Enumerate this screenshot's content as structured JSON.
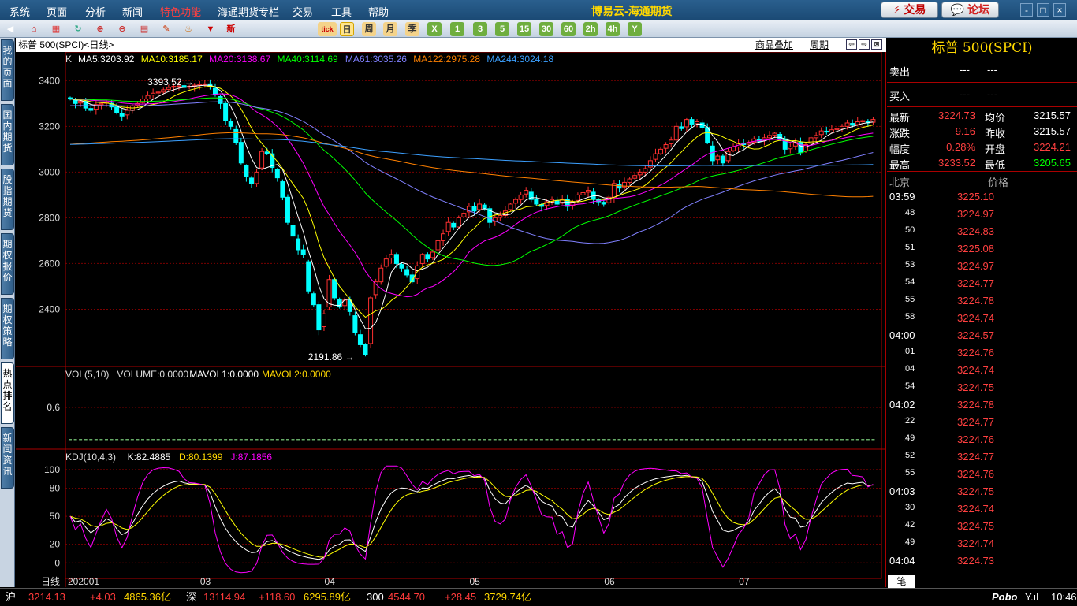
{
  "menu": [
    "系统",
    "页面",
    "分析",
    "新闻",
    "特色功能",
    "海通期货专栏",
    "交易",
    "工具",
    "帮助"
  ],
  "app_title": "博易云-海通期货",
  "buttons": {
    "trade": "交易",
    "forum": "论坛"
  },
  "window_controls": [
    "-",
    "□",
    "×"
  ],
  "toolbar": {
    "nav_icons": [
      "back-icon",
      "home-icon",
      "page-icon",
      "refresh-icon",
      "zoom-in-icon",
      "zoom-out-icon",
      "layout-icon",
      "draw-icon",
      "indicator-icon",
      "filter-icon",
      "new-icon"
    ],
    "periods": [
      "tick",
      "日",
      "周",
      "月",
      "季",
      "X",
      "1",
      "3",
      "5",
      "15",
      "30",
      "60",
      "2h",
      "4h",
      "Y"
    ],
    "active_period": "日"
  },
  "sidetabs": [
    "我的页面",
    "国内期货",
    "股指期货",
    "期权报价",
    "期权策略",
    "热点排名",
    "新闻资讯"
  ],
  "active_sidetab": "热点排名",
  "chart_header": {
    "title": "标普 500(SPCI)<日线>",
    "overlay": "商品叠加",
    "period": "周期"
  },
  "main_legend": {
    "k": "K",
    "ma": [
      {
        "label": "MA5:3203.92",
        "color": "#ffffff"
      },
      {
        "label": "MA10:3185.17",
        "color": "#ffff00"
      },
      {
        "label": "MA20:3138.67",
        "color": "#ff00ff"
      },
      {
        "label": "MA40:3114.69",
        "color": "#00ff00"
      },
      {
        "label": "MA61:3035.26",
        "color": "#8080ff"
      },
      {
        "label": "MA122:2975.28",
        "color": "#ff8000"
      },
      {
        "label": "MA244:3024.18",
        "color": "#3ca0ff"
      }
    ]
  },
  "vol_legend": {
    "title": "VOL(5,10)",
    "volume": "VOLUME:0.0000",
    "mavol1": "MAVOL1:0.0000",
    "mavol2": "MAVOL2:0.0000"
  },
  "kdj_legend": {
    "title": "KDJ(10,4,3)",
    "k": "K:82.4885",
    "d": "D:80.1399",
    "j": "J:87.1856"
  },
  "x_axis": {
    "label": "日线",
    "ticks": [
      "202001",
      "03",
      "04",
      "05",
      "06",
      "07"
    ]
  },
  "colors": {
    "up": "#ff3030",
    "down": "#00ffff",
    "grid": "#7a0000"
  },
  "chart_data": [
    {
      "type": "candlestick",
      "name": "main",
      "y_axis_ticks": [
        3400,
        3200,
        3000,
        2800,
        2600,
        2400
      ],
      "ylim": [
        2150,
        3470
      ],
      "annotations": [
        {
          "text": "3393.52",
          "value": 3393.52
        },
        {
          "text": "2191.86",
          "value": 2191.86
        }
      ],
      "close": [
        3320,
        3300,
        3310,
        3280,
        3270,
        3295,
        3300,
        3305,
        3285,
        3260,
        3245,
        3270,
        3290,
        3300,
        3320,
        3335,
        3345,
        3350,
        3360,
        3370,
        3375,
        3380,
        3370,
        3375,
        3380,
        3385,
        3386,
        3373,
        3338,
        3300,
        3225,
        3200,
        3130,
        3040,
        2980,
        2950,
        3000,
        3090,
        3080,
        3020,
        2975,
        2890,
        2780,
        2720,
        2660,
        2640,
        2480,
        2420,
        2310,
        2380,
        2530,
        2450,
        2410,
        2440,
        2390,
        2300,
        2245,
        2200,
        2450,
        2520,
        2580,
        2620,
        2640,
        2600,
        2580,
        2550,
        2520,
        2590,
        2640,
        2620,
        2650,
        2700,
        2730,
        2780,
        2760,
        2800,
        2820,
        2850,
        2830,
        2860,
        2840,
        2780,
        2800,
        2810,
        2830,
        2860,
        2880,
        2900,
        2920,
        2880,
        2860,
        2850,
        2870,
        2880,
        2860,
        2880,
        2850,
        2870,
        2900,
        2910,
        2920,
        2880,
        2870,
        2860,
        2890,
        2950,
        2930,
        2955,
        2970,
        2985,
        3000,
        3015,
        3050,
        3080,
        3100,
        3120,
        3140,
        3200,
        3190,
        3230,
        3210,
        3220,
        3195,
        3130,
        3050,
        3070,
        3040,
        3090,
        3110,
        3125,
        3120,
        3130,
        3145,
        3135,
        3150,
        3160,
        3170,
        3145,
        3100,
        3110,
        3130,
        3085,
        3120,
        3150,
        3160,
        3180,
        3175,
        3185,
        3190,
        3200,
        3215,
        3205,
        3220,
        3225,
        3215,
        3230
      ],
      "ma_series_names": [
        "MA5",
        "MA10",
        "MA20",
        "MA40",
        "MA61",
        "MA122",
        "MA244"
      ]
    },
    {
      "type": "bar",
      "name": "volume",
      "y_axis_ticks": [
        0.6
      ],
      "values_note_free": true,
      "ylim": [
        0,
        1
      ]
    },
    {
      "type": "line",
      "name": "kdj",
      "y_axis_ticks": [
        100,
        80,
        50,
        20,
        0
      ],
      "ylim": [
        -15,
        105
      ],
      "series": [
        {
          "name": "K",
          "color": "#ffffff"
        },
        {
          "name": "D",
          "color": "#ffff00"
        },
        {
          "name": "J",
          "color": "#ff00ff"
        }
      ]
    }
  ],
  "quote": {
    "title": "标普 500(SPCI)",
    "sell": {
      "label": "卖出",
      "price": "---",
      "vol": "---"
    },
    "buy": {
      "label": "买入",
      "price": "---",
      "vol": "---"
    },
    "rows": [
      {
        "l1": "最新",
        "v1": "3224.73",
        "c1": "#ff4040",
        "l2": "均价",
        "v2": "3215.57",
        "c2": "#ffffff"
      },
      {
        "l1": "涨跌",
        "v1": "9.16",
        "c1": "#ff4040",
        "l2": "昨收",
        "v2": "3215.57",
        "c2": "#ffffff"
      },
      {
        "l1": "幅度",
        "v1": "0.28%",
        "c1": "#ff4040",
        "l2": "开盘",
        "v2": "3224.21",
        "c2": "#ff4040"
      },
      {
        "l1": "最高",
        "v1": "3233.52",
        "c1": "#ff4040",
        "l2": "最低",
        "v2": "3205.65",
        "c2": "#00ff00"
      }
    ],
    "tick_header": {
      "time": "北京",
      "price": "价格"
    },
    "ticks": [
      {
        "t": "03:59",
        "v": "3225.10",
        "major": true
      },
      {
        "t": ":48",
        "v": "3224.97"
      },
      {
        "t": ":50",
        "v": "3224.83"
      },
      {
        "t": ":51",
        "v": "3225.08"
      },
      {
        "t": ":53",
        "v": "3224.97"
      },
      {
        "t": ":54",
        "v": "3224.77"
      },
      {
        "t": ":55",
        "v": "3224.78"
      },
      {
        "t": ":58",
        "v": "3224.74"
      },
      {
        "t": "04:00",
        "v": "3224.57",
        "major": true
      },
      {
        "t": ":01",
        "v": "3224.76"
      },
      {
        "t": ":04",
        "v": "3224.74"
      },
      {
        "t": ":54",
        "v": "3224.75"
      },
      {
        "t": "04:02",
        "v": "3224.78",
        "major": true
      },
      {
        "t": ":22",
        "v": "3224.77"
      },
      {
        "t": ":49",
        "v": "3224.76"
      },
      {
        "t": ":52",
        "v": "3224.77"
      },
      {
        "t": ":55",
        "v": "3224.76"
      },
      {
        "t": "04:03",
        "v": "3224.75",
        "major": true
      },
      {
        "t": ":30",
        "v": "3224.74"
      },
      {
        "t": ":42",
        "v": "3224.75"
      },
      {
        "t": ":49",
        "v": "3224.74"
      },
      {
        "t": "04:04",
        "v": "3224.73",
        "major": true
      }
    ],
    "tab": "笔"
  },
  "status": {
    "sh_label": "沪",
    "sh_val": "3214.13",
    "sh_chg": "+4.03",
    "sh_amt": "4865.36亿",
    "sz_label": "深",
    "sz_val": "13114.94",
    "sz_chg": "+118.60",
    "sz_amt": "6295.89亿",
    "c300_label": "300",
    "c300_val": "4544.70",
    "c300_chg": "+28.45",
    "c300_amt": "3729.74亿",
    "brand": "Pobo",
    "time": "10:46"
  }
}
